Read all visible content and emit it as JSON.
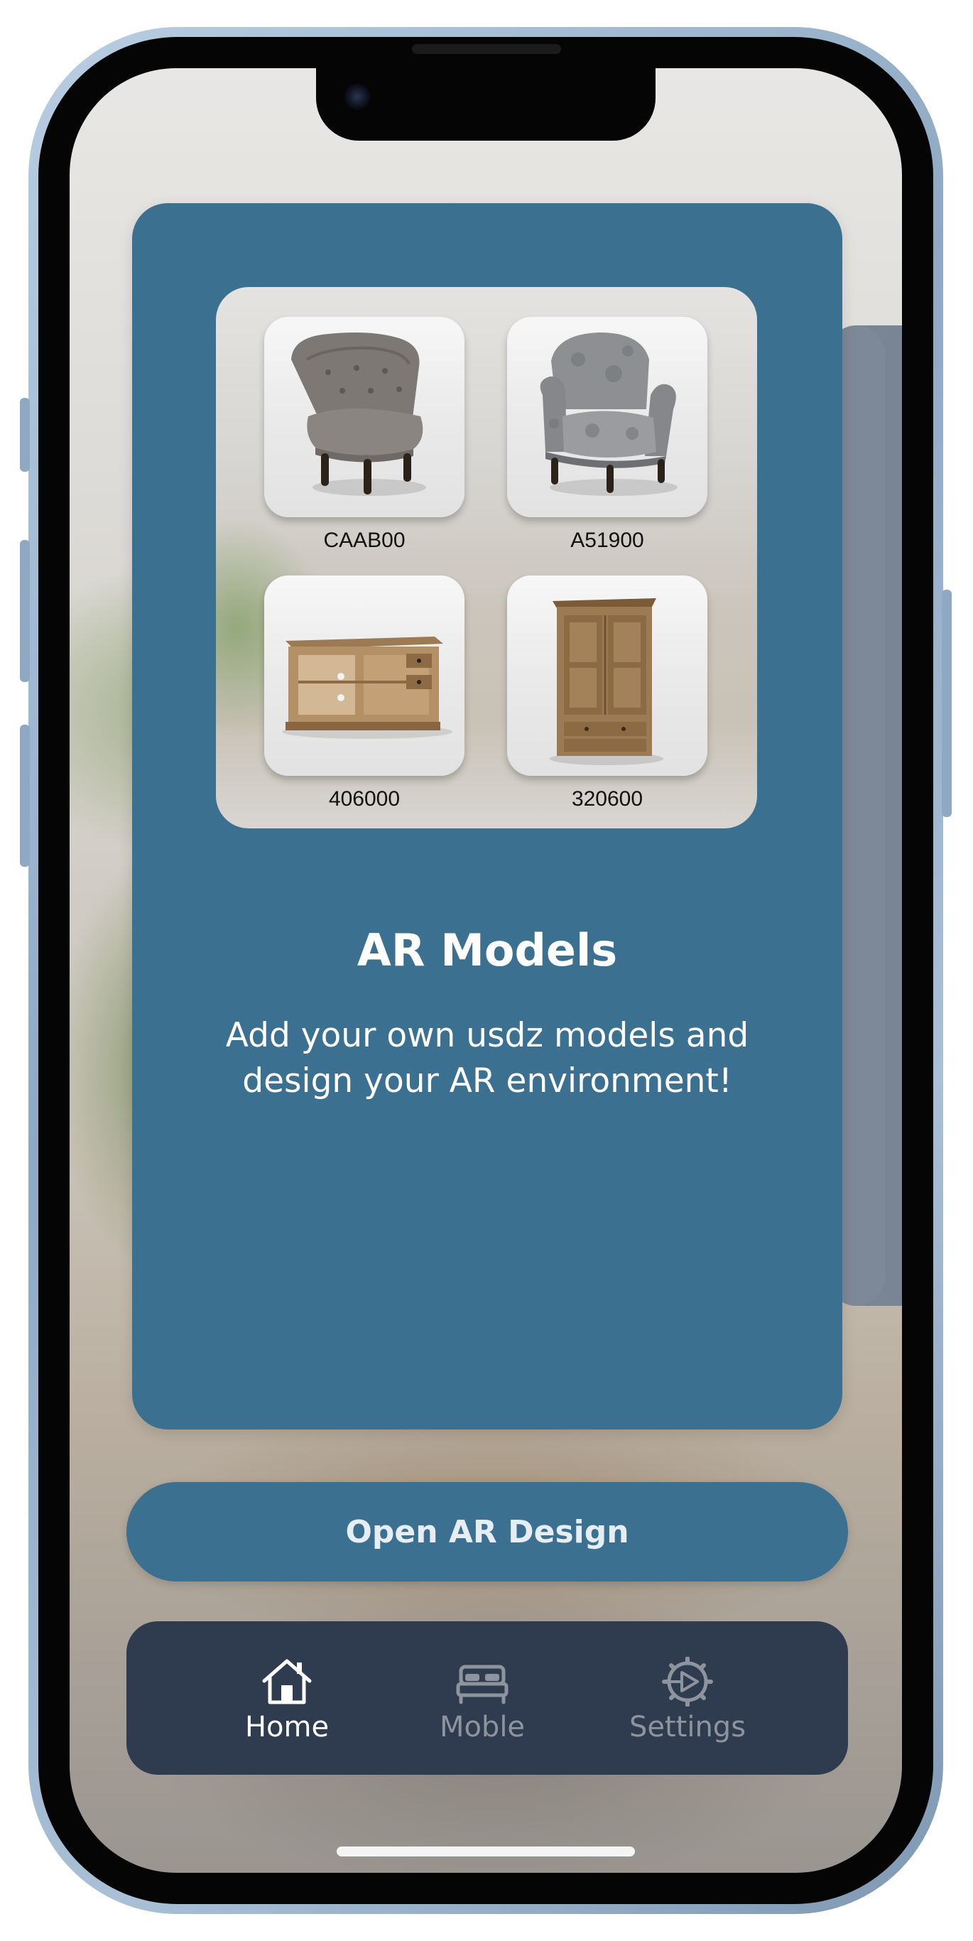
{
  "card": {
    "title": "AR Models",
    "description": "Add your own usdz models and design your AR environment!",
    "models": [
      {
        "code": "CAAB00",
        "icon": "tufted-chair-icon"
      },
      {
        "code": "A51900",
        "icon": "armchair-icon"
      },
      {
        "code": "406000",
        "icon": "sideboard-icon"
      },
      {
        "code": "320600",
        "icon": "wardrobe-icon"
      }
    ]
  },
  "actions": {
    "open_label": "Open AR Design"
  },
  "tabbar": {
    "items": [
      {
        "label": "Home",
        "icon": "house-icon",
        "active": true
      },
      {
        "label": "Moble",
        "icon": "bed-icon",
        "active": false
      },
      {
        "label": "Settings",
        "icon": "gear-icon",
        "active": false
      }
    ]
  },
  "colors": {
    "card": "#3b7090",
    "tab_bar": "#2f3b4f",
    "tab_active": "#ffffff",
    "tab_inactive": "#8e949e"
  }
}
